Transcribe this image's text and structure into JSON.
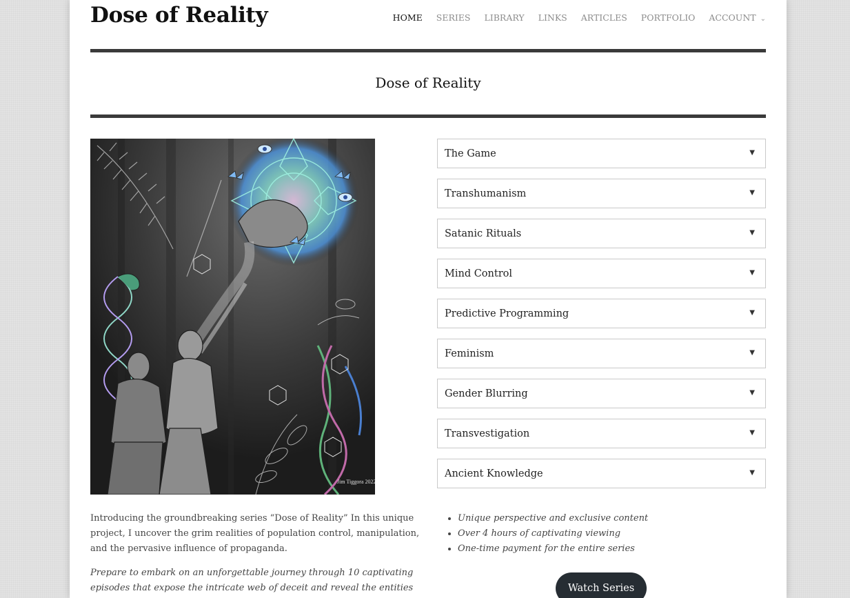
{
  "header": {
    "site_title": "Dose of Reality",
    "nav": [
      {
        "label": "HOME",
        "active": true
      },
      {
        "label": "SERIES",
        "active": false
      },
      {
        "label": "LIBRARY",
        "active": false
      },
      {
        "label": "LINKS",
        "active": false
      },
      {
        "label": "ARTICLES",
        "active": false
      },
      {
        "label": "PORTFOLIO",
        "active": false
      },
      {
        "label": "ACCOUNT",
        "active": false,
        "has_dropdown": true
      }
    ]
  },
  "page_title": "Dose of Reality",
  "artwork": {
    "signature": "Jim Tiggora 2022"
  },
  "accordion": [
    {
      "label": "The Game"
    },
    {
      "label": "Transhumanism"
    },
    {
      "label": "Satanic Rituals"
    },
    {
      "label": "Mind Control"
    },
    {
      "label": "Predictive Programming"
    },
    {
      "label": "Feminism"
    },
    {
      "label": "Gender Blurring"
    },
    {
      "label": "Transvestigation"
    },
    {
      "label": "Ancient Knowledge"
    }
  ],
  "intro": {
    "paragraph1": "Introducing the groundbreaking series “Dose of Reality” In this unique project, I uncover the grim realities of population control, manipulation, and the pervasive influence of propaganda.",
    "paragraph2": "Prepare to embark on an unforgettable journey through 10 captivating episodes that expose the intricate web of deceit and reveal the entities that"
  },
  "features": [
    "Unique perspective and exclusive content",
    "Over 4 hours of captivating viewing",
    "One-time payment for the entire series"
  ],
  "cta": {
    "label": "Watch Series"
  },
  "colors": {
    "rule": "#3a3a3a",
    "button": "#262d33",
    "nav_inactive": "#8c8c8c",
    "nav_active": "#111111"
  },
  "icons": {
    "accordion_toggle": "triangle-down-icon",
    "nav_dropdown": "chevron-down-icon"
  }
}
